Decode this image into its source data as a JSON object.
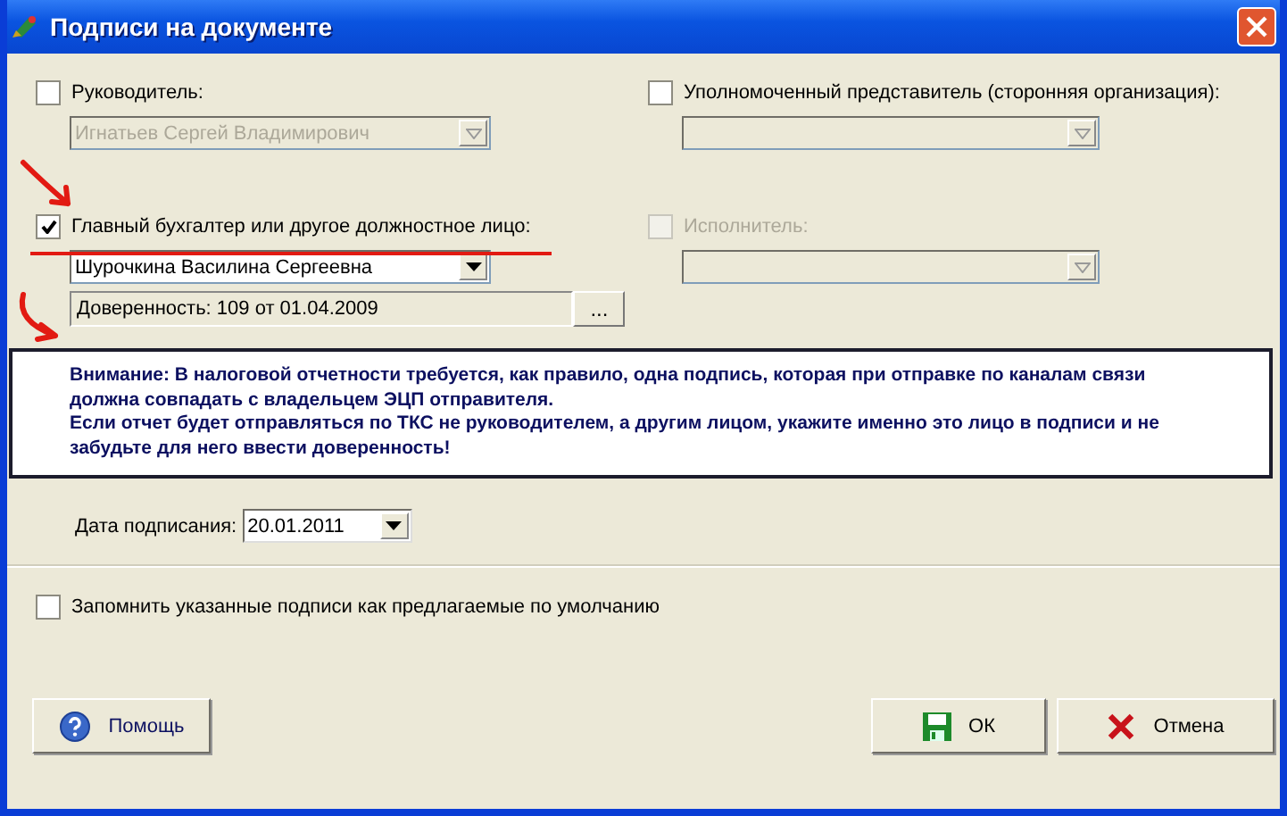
{
  "window": {
    "title": "Подписи на документе"
  },
  "signers": [
    {
      "label": "Руководитель:",
      "checked": false,
      "disabled": false,
      "combo": {
        "value": "Игнатьев Сергей Владимирович",
        "disabled": true
      }
    },
    {
      "label": "Уполномоченный представитель (сторонняя организация):",
      "checked": false,
      "disabled": false,
      "combo": {
        "disabled": true
      }
    },
    {
      "label": "Главный бухгалтер или другое должностное лицо:",
      "checked": true,
      "disabled": false,
      "combo": {
        "value": "Шурочкина Василина Сергеевна",
        "disabled": false
      },
      "proxy": {
        "value": "Доверенность: 109 от 01.04.2009",
        "button": "..."
      }
    },
    {
      "label": "Исполнитель:",
      "checked": false,
      "disabled": true,
      "combo": {
        "disabled": true
      }
    }
  ],
  "notice": [
    "Внимание: В налоговой отчетности требуется, как правило, одна подпись, которая при отправке по каналам связи должна совпадать с владельцем ЭЦП отправителя.",
    "Если отчет будет отправляться по ТКС не руководителем, а другим лицом, укажите именно это лицо в подписи и не забудьте для него ввести доверенность!"
  ],
  "date": {
    "label": "Дата подписания:",
    "value": "20.01.2011"
  },
  "remember": {
    "label": "Запомнить указанные подписи как предлагаемые по умолчанию",
    "checked": false
  },
  "buttons": [
    {
      "kind": "help",
      "label": "Помощь"
    },
    {
      "kind": "ok",
      "label": "ОК"
    },
    {
      "kind": "cancel",
      "label": "Отмена"
    }
  ]
}
